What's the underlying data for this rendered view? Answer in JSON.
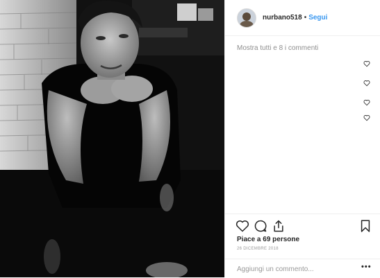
{
  "header": {
    "username": "nurbano518",
    "separator": "•",
    "follow_label": "Segui"
  },
  "comments": {
    "show_all_label": "Mostra tutti e 8 i commenti"
  },
  "actions": {
    "likes_text": "Piace a 69 persone",
    "date_text": "26 DICEMBRE 2018"
  },
  "add_comment": {
    "placeholder": "Aggiungi un commento...",
    "more_label": "•••"
  },
  "colors": {
    "link": "#3897f0",
    "muted": "#8e8e8e"
  }
}
